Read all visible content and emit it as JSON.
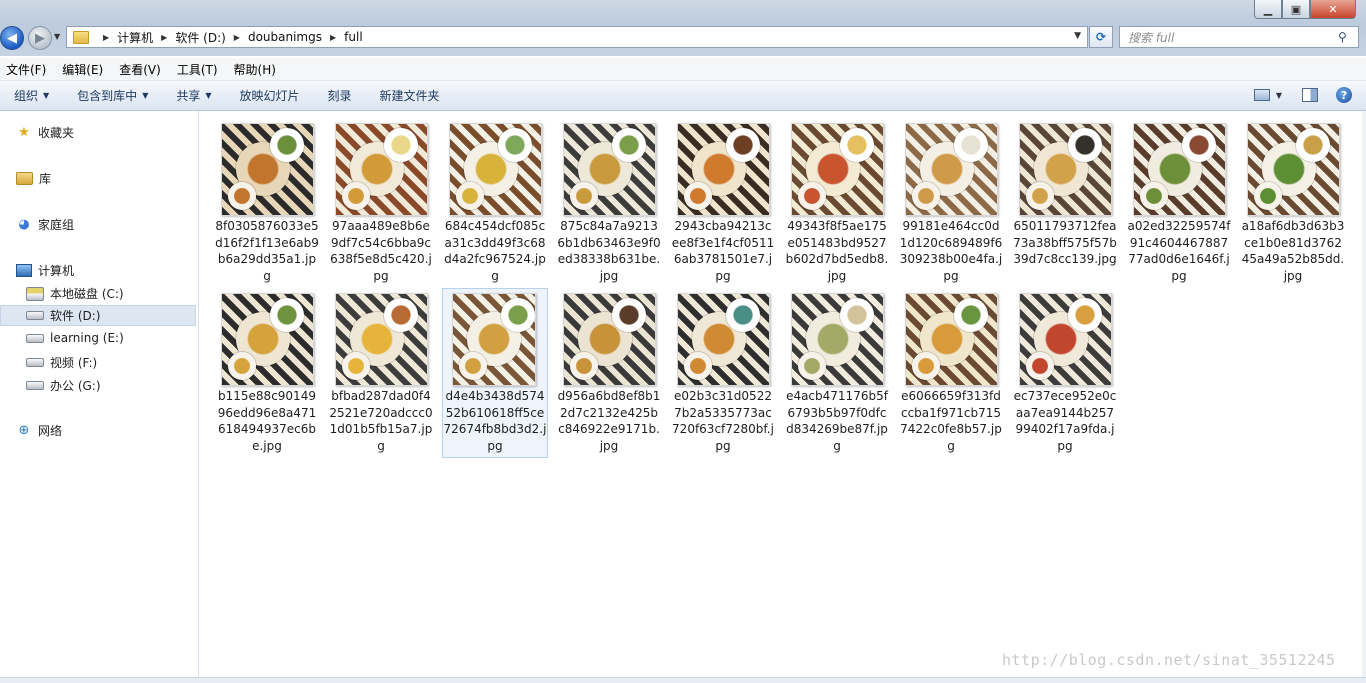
{
  "window": {
    "controls": [
      "minimize",
      "maximize",
      "close"
    ]
  },
  "address": {
    "breadcrumbs": [
      "计算机",
      "软件 (D:)",
      "doubanimgs",
      "full"
    ]
  },
  "search": {
    "placeholder": "搜索 full"
  },
  "menu": [
    "文件(F)",
    "编辑(E)",
    "查看(V)",
    "工具(T)",
    "帮助(H)"
  ],
  "toolbar": {
    "organize": "组织",
    "include_in_library": "包含到库中",
    "share": "共享",
    "slideshow": "放映幻灯片",
    "burn": "刻录",
    "new_folder": "新建文件夹"
  },
  "nav": {
    "favorites": "收藏夹",
    "libraries": "库",
    "homegroup": "家庭组",
    "computer": "计算机",
    "drives": [
      "本地磁盘 (C:)",
      "软件 (D:)",
      "learning (E:)",
      "视频 (F:)",
      "办公 (G:)"
    ],
    "network": "网络"
  },
  "files": [
    {
      "name": "8f0305876033e5d16f2f1f13e6ab9b6a29dd35a1.jpg",
      "colors": [
        "#2b2b2b",
        "#e7d7b8",
        "#c2752e",
        "#6b8f3a"
      ]
    },
    {
      "name": "97aaa489e8b6e9df7c54c6bba9c638f5e8d5c420.jpg",
      "colors": [
        "#8a4a2a",
        "#f2ead8",
        "#d39a3a",
        "#e9d88a"
      ]
    },
    {
      "name": "684c454dcf085ca31c3dd49f3c68d4a2fc967524.jpg",
      "colors": [
        "#7a4e2c",
        "#f4f0e6",
        "#d9b23c",
        "#7fa85b"
      ]
    },
    {
      "name": "875c84a7a92136b1db63463e9f0ed38338b631be.jpg",
      "colors": [
        "#3c3c3c",
        "#eee8d8",
        "#c99a3e",
        "#7a9e4a"
      ]
    },
    {
      "name": "2943cba94213cee8f3e1f4cf05116ab3781501e7.jpg",
      "colors": [
        "#3a2c22",
        "#f0e4cc",
        "#d07a2e",
        "#6f3f24"
      ]
    },
    {
      "name": "49343f8f5ae175e051483bd9527b602d7bd5edb8.jpg",
      "colors": [
        "#6a4a30",
        "#f3ead4",
        "#c8552e",
        "#e4c060"
      ]
    },
    {
      "name": "99181e464cc0d1d120c689489f6309238b00e4fa.jpg",
      "colors": [
        "#8c6a48",
        "#f4efe4",
        "#cf9a4a",
        "#e8e2d4"
      ]
    },
    {
      "name": "65011793712fea73a38bff575f57b39d7c8cc139.jpg",
      "colors": [
        "#5a4636",
        "#efe6d4",
        "#d2a24a",
        "#34302c"
      ]
    },
    {
      "name": "a02ed32259574f91c460446788777ad0d6e1646f.jpg",
      "colors": [
        "#5a3c2a",
        "#f2ece0",
        "#6e8f3a",
        "#8a4a32"
      ]
    },
    {
      "name": "a18af6db3d63b3ce1b0e81d376245a49a52b85dd.jpg",
      "colors": [
        "#6a4a30",
        "#f4f0e6",
        "#5d8f34",
        "#c8a04a"
      ]
    },
    {
      "name": "b115e88c9014996edd96e8a471618494937ec6be.jpg",
      "colors": [
        "#2c2c2c",
        "#eee6d2",
        "#d6a23c",
        "#6e9440"
      ]
    },
    {
      "name": "bfbad287dad0f42521e720adccc01d01b5fb15a7.jpg",
      "colors": [
        "#3c3c3c",
        "#f0e8d6",
        "#e6b43a",
        "#b86a34"
      ]
    },
    {
      "name": "d4e4b3438d57452b610618ff5ce72674fb8bd3d2.jpg",
      "colors": [
        "#7a5638",
        "#f4f0e6",
        "#d2a040",
        "#7a9e4c"
      ]
    },
    {
      "name": "d956a6bd8ef8b12d7c2132e425bc846922e9171b.jpg",
      "colors": [
        "#3a3a3a",
        "#ece4d2",
        "#c8923a",
        "#5a3c28"
      ]
    },
    {
      "name": "e02b3c31d05227b2a5335773ac720f63cf7280bf.jpg",
      "colors": [
        "#2e2e2e",
        "#f0e8d6",
        "#d08a34",
        "#4a8f86"
      ]
    },
    {
      "name": "e4acb471176b5f6793b5b97f0dfcd834269be87f.jpg",
      "colors": [
        "#3a3a3a",
        "#f2ecdf",
        "#a2aa66",
        "#d4c39a"
      ]
    },
    {
      "name": "e6066659f313fdccba1f971cb7157422c0fe8b57.jpg",
      "colors": [
        "#6a4a30",
        "#f0e6cc",
        "#d89a3a",
        "#6b9440"
      ]
    },
    {
      "name": "ec737ece952e0caa7ea9144b25799402f17a9fda.jpg",
      "colors": [
        "#3c3c3c",
        "#f0e8d8",
        "#c2462e",
        "#d8a040"
      ]
    }
  ],
  "selected_file_index": 12,
  "watermark": "http://blog.csdn.net/sinat_35512245"
}
